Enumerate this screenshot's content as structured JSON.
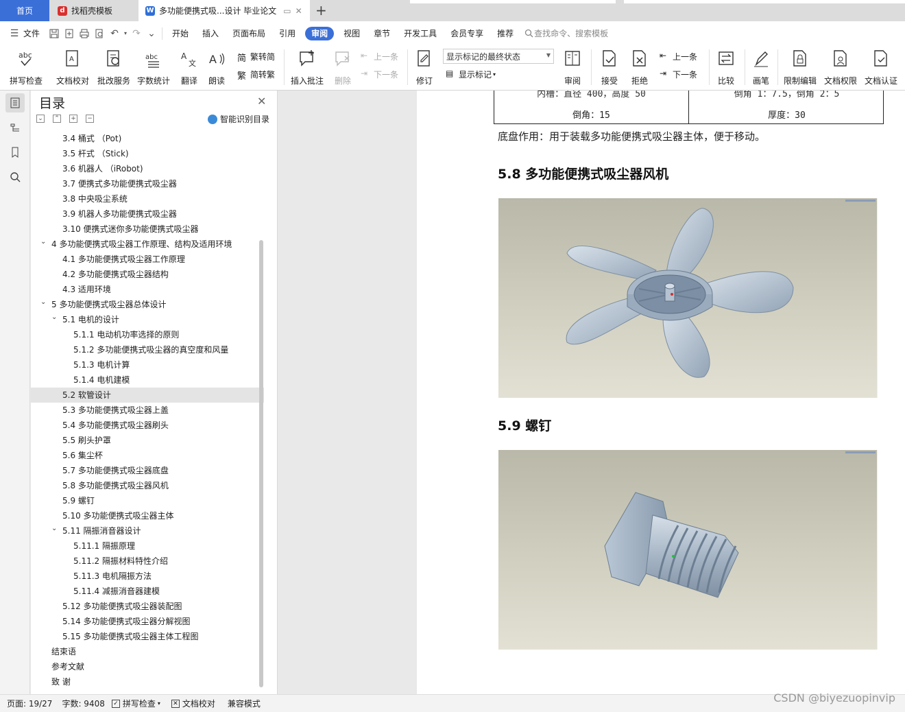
{
  "tabs": {
    "home": "首页",
    "template": "找稻壳模板",
    "document": "多功能便携式吸...设计 毕业论文"
  },
  "menu": {
    "file": "文件",
    "items": [
      "开始",
      "插入",
      "页面布局",
      "引用",
      "审阅",
      "视图",
      "章节",
      "开发工具",
      "会员专享",
      "推荐"
    ],
    "active": "审阅",
    "search_placeholder": "查找命令、搜索模板"
  },
  "ribbon": {
    "spell_check": "拼写检查",
    "doc_proof": "文档校对",
    "revise_service": "批改服务",
    "word_count": "字数统计",
    "translate": "翻译",
    "read_aloud": "朗读",
    "trad_to_simp": "繁转简",
    "simp_to_trad": "简转繁",
    "insert_comment": "插入批注",
    "delete": "删除",
    "prev": "上一条",
    "next": "下一条",
    "track_changes": "修订",
    "markup_state": "显示标记的最终状态",
    "show_markup": "显示标记",
    "review": "审阅",
    "accept": "接受",
    "reject": "拒绝",
    "prev2": "上一条",
    "next2": "下一条",
    "compare": "比较",
    "pen": "画笔",
    "restrict_edit": "限制编辑",
    "doc_permission": "文档权限",
    "doc_cert": "文档认证"
  },
  "toc": {
    "title": "目录",
    "smart": "智能识别目录",
    "items": [
      {
        "text": "3.4  桶式  （Pot)",
        "level": 2
      },
      {
        "text": "3.5  杆式  （Stick)",
        "level": 2
      },
      {
        "text": "3.6  机器人  （iRobot)",
        "level": 2
      },
      {
        "text": "3.7 便携式多功能便携式吸尘器",
        "level": 2
      },
      {
        "text": "3.8 中央吸尘系统",
        "level": 2
      },
      {
        "text": "3.9 机器人多功能便携式吸尘器",
        "level": 2
      },
      {
        "text": "3.10 便携式迷你多功能便携式吸尘器",
        "level": 2
      },
      {
        "text": "4  多功能便携式吸尘器工作原理、结构及适用环境",
        "level": 1,
        "expanded": true
      },
      {
        "text": "4.1  多功能便携式吸尘器工作原理",
        "level": 2
      },
      {
        "text": "4.2  多功能便携式吸尘器结构",
        "level": 2
      },
      {
        "text": "4.3  适用环境",
        "level": 2
      },
      {
        "text": "5  多功能便携式吸尘器总体设计",
        "level": 1,
        "expanded": true
      },
      {
        "text": "5.1 电机的设计",
        "level": 2,
        "expanded": true
      },
      {
        "text": "5.1.1 电动机功率选择的原则",
        "level": 3
      },
      {
        "text": "5.1.2 多功能便携式吸尘器的真空度和风量",
        "level": 3
      },
      {
        "text": "5.1.3 电机计算",
        "level": 3
      },
      {
        "text": "5.1.4 电机建模",
        "level": 3
      },
      {
        "text": "5.2 软管设计",
        "level": 2,
        "selected": true
      },
      {
        "text": "5.3 多功能便携式吸尘器上盖",
        "level": 2
      },
      {
        "text": "5.4 多功能便携式吸尘器刷头",
        "level": 2
      },
      {
        "text": "5.5 刷头护罩",
        "level": 2
      },
      {
        "text": "5.6 集尘杯",
        "level": 2
      },
      {
        "text": "5.7 多功能便携式吸尘器底盘",
        "level": 2
      },
      {
        "text": "5.8 多功能便携式吸尘器风机",
        "level": 2
      },
      {
        "text": "5.9 螺钉",
        "level": 2
      },
      {
        "text": "5.10 多功能便携式吸尘器主体",
        "level": 2
      },
      {
        "text": "5.11 隔振消音器设计",
        "level": 2,
        "expanded": true
      },
      {
        "text": "5.11.1 隔振原理",
        "level": 3
      },
      {
        "text": "5.11.2 隔振材料特性介绍",
        "level": 3
      },
      {
        "text": "5.11.3 电机隔振方法",
        "level": 3
      },
      {
        "text": "5.11.4 减振消音器建模",
        "level": 3
      },
      {
        "text": "5.12 多功能便携式吸尘器装配图",
        "level": 2
      },
      {
        "text": "5.14 多功能便携式吸尘器分解视图",
        "level": 2
      },
      {
        "text": "5.15 多功能便携式吸尘器主体工程图",
        "level": 2
      },
      {
        "text": "结束语",
        "level": 1
      },
      {
        "text": "参考文献",
        "level": 1
      },
      {
        "text": "致  谢",
        "level": 1
      }
    ]
  },
  "document": {
    "table": {
      "left_top": "内槽：直径 400，高度 50",
      "left_bottom": "倒角：15",
      "right_top": "倒角 1：7.5，倒角 2：5",
      "right_bottom": "厚度：30"
    },
    "base_note": "底盘作用：用于装载多功能便携式吸尘器主体，便于移动。",
    "heading_fan": "5.8 多功能便携式吸尘器风机",
    "heading_screw": "5.9 螺钉"
  },
  "status": {
    "page": "页面: 19/27",
    "words": "字数: 9408",
    "spell": "拼写检查",
    "proof": "文档校对",
    "compat": "兼容模式"
  },
  "watermark": "CSDN @biyezuopinvip",
  "colors": {
    "accent": "#3b6fd8",
    "render_bg_top": "#b9b8a9",
    "render_bg_bottom": "#e3e1d4",
    "part_color": "#b8c6d6"
  }
}
